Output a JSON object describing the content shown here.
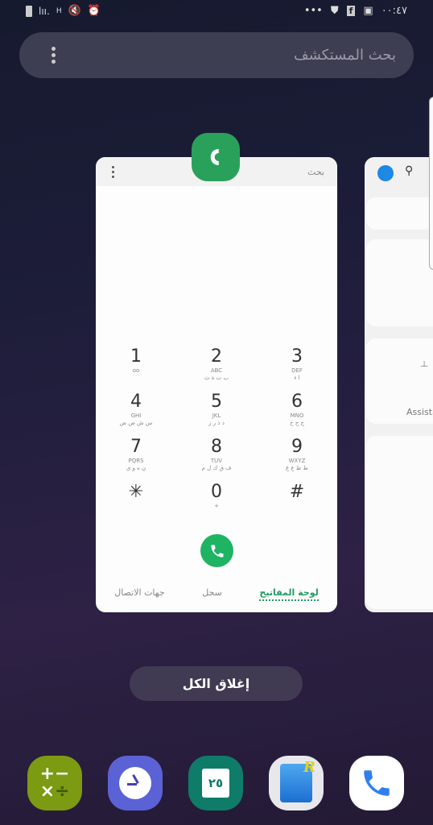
{
  "status_bar": {
    "time": "٠٠:٤٧",
    "network_type": "H",
    "icons_left": [
      "battery-icon",
      "signal-icon",
      "data-arrows-icon",
      "mute-icon",
      "alarm-icon"
    ],
    "icons_right": [
      "more-notifications-icon",
      "shield-icon",
      "facebook-icon",
      "image-icon"
    ]
  },
  "search": {
    "placeholder": "بحث المستكشف"
  },
  "phone_card": {
    "search_label": "بحث",
    "keys": [
      {
        "n": "1",
        "l": "ᴏᴏ",
        "a": ""
      },
      {
        "n": "2",
        "l": "ABC",
        "a": "ب ت ة ث"
      },
      {
        "n": "3",
        "l": "DEF",
        "a": "ا ء"
      },
      {
        "n": "4",
        "l": "GHI",
        "a": "س ش ص ض"
      },
      {
        "n": "5",
        "l": "JKL",
        "a": "د ذ ر ز"
      },
      {
        "n": "6",
        "l": "MNO",
        "a": "ج ح خ"
      },
      {
        "n": "7",
        "l": "PQRS",
        "a": "ن ه و ي"
      },
      {
        "n": "8",
        "l": "TUV",
        "a": "ف ق ك ل م"
      },
      {
        "n": "9",
        "l": "WXYZ",
        "a": "ط ظ ع غ"
      },
      {
        "n": "✳",
        "l": "",
        "a": ""
      },
      {
        "n": "0",
        "l": "+",
        "a": ""
      },
      {
        "n": "#",
        "l": "",
        "a": ""
      }
    ],
    "tabs": [
      "لوحة المفاتيح",
      "سجل",
      "جهات الاتصال"
    ],
    "active_tab": "لوحة المفاتيح",
    "accent": "#1f9a63"
  },
  "second_card": {
    "partial_text_1": "ـلـ",
    "partial_text_2": "Assista"
  },
  "close_all": "إغلاق الكل",
  "calendar_day": "٢٥",
  "dock": [
    "calculator",
    "clock",
    "calendar",
    "file-manager",
    "phone"
  ]
}
